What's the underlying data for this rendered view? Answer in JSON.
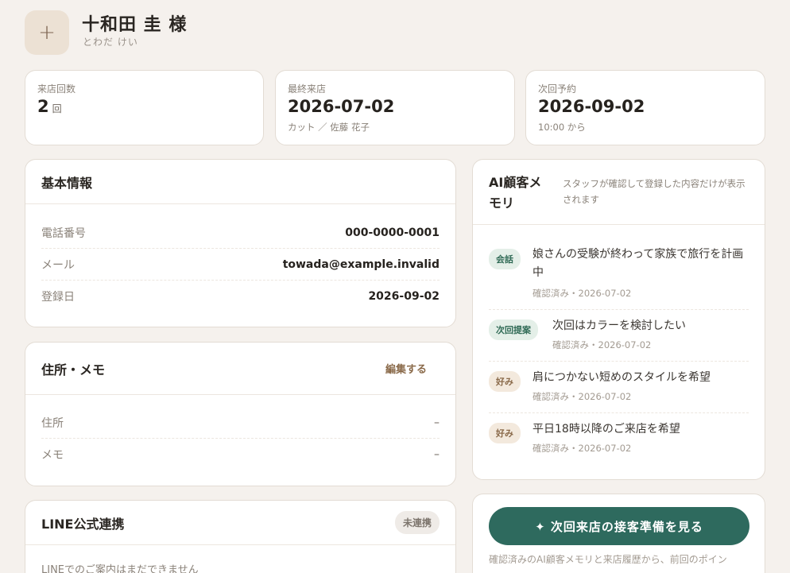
{
  "customer": {
    "name": "十和田 圭 様",
    "kana": "とわだ けい",
    "avatar_icon": "plus-icon"
  },
  "stats": [
    {
      "label": "来店回数",
      "value": "2",
      "unit": "回",
      "sub": ""
    },
    {
      "label": "最終来店",
      "value": "2026-07-02",
      "sub": "カット ／ 佐藤 花子"
    },
    {
      "label": "次回予約",
      "value": "2026-09-02",
      "sub": "10:00 から"
    }
  ],
  "basic_info": {
    "title": "基本情報",
    "rows": [
      {
        "label": "電話番号",
        "value": "000-0000-0001"
      },
      {
        "label": "メール",
        "value": "towada@example.invalid"
      },
      {
        "label": "登録日",
        "value": "2026-09-02"
      }
    ]
  },
  "address_memo": {
    "title": "住所・メモ",
    "edit_label": "編集する",
    "rows": [
      {
        "label": "住所",
        "value": "–"
      },
      {
        "label": "メモ",
        "value": "–"
      }
    ]
  },
  "line": {
    "title": "LINE公式連携",
    "status": "未連携",
    "body": "LINEでのご案内はまだできません"
  },
  "ai_memory": {
    "title": "AI顧客メモリ",
    "note": "スタッフが確認して登録した内容だけが表示されます",
    "items": [
      {
        "tag": "会話",
        "text": "娘さんの受験が終わって家族で旅行を計画中",
        "meta": "確認済み・2026-07-02"
      },
      {
        "tag": "次回提案",
        "text": "次回はカラーを検討したい",
        "meta": "確認済み・2026-07-02"
      },
      {
        "tag": "好み",
        "text": "肩につかない短めのスタイルを希望",
        "meta": "確認済み・2026-07-02"
      },
      {
        "tag": "好み",
        "text": "平日18時以降のご来店を希望",
        "meta": "確認済み・2026-07-02"
      }
    ]
  },
  "prep": {
    "button_label": "✦ 次回来店の接客準備を見る",
    "note": "確認済みのAI顧客メモリと来店履歴から、前回のポイン"
  },
  "colors": {
    "background": "#f5f1ed",
    "accent": "#2e6a5e",
    "tag_green": "#e4efe8",
    "tag_beige": "#f3e9dd"
  }
}
